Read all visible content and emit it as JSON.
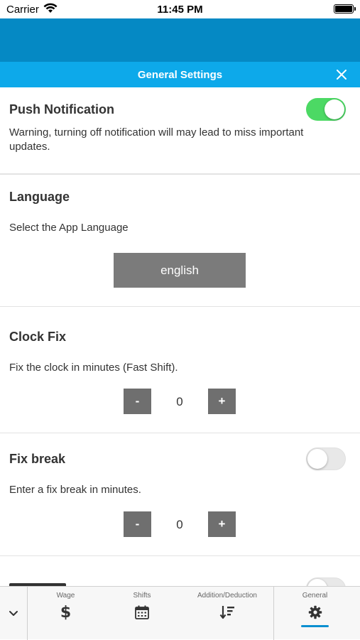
{
  "status_bar": {
    "carrier": "Carrier",
    "time": "11:45 PM"
  },
  "header": {
    "title": "General Settings"
  },
  "push_notification": {
    "title": "Push Notification",
    "description": "Warning, turning off notification will may lead to miss important updates.",
    "enabled": true
  },
  "language": {
    "title": "Language",
    "description": "Select the App Language",
    "selected": "english"
  },
  "clock_fix": {
    "title": "Clock Fix",
    "description": "Fix the clock in minutes (Fast Shift).",
    "minus_label": "-",
    "value": "0",
    "plus_label": "+"
  },
  "fix_break": {
    "title": "Fix break",
    "description": "Enter a fix break in minutes.",
    "enabled": false,
    "minus_label": "-",
    "value": "0",
    "plus_label": "+"
  },
  "tab_bar": {
    "tabs": [
      {
        "label": "Wage",
        "icon": "dollar-icon"
      },
      {
        "label": "Shifts",
        "icon": "calendar-icon"
      },
      {
        "label": "Addition/Deduction",
        "icon": "sort-icon"
      },
      {
        "label": "General",
        "icon": "gear-icon",
        "active": true
      }
    ]
  },
  "colors": {
    "header_band": "#0589c4",
    "title_bar": "#0da9ea",
    "toggle_on": "#4cd964",
    "button_gray": "#6f6f6f",
    "active_tab_indicator": "#0a8fd0"
  }
}
